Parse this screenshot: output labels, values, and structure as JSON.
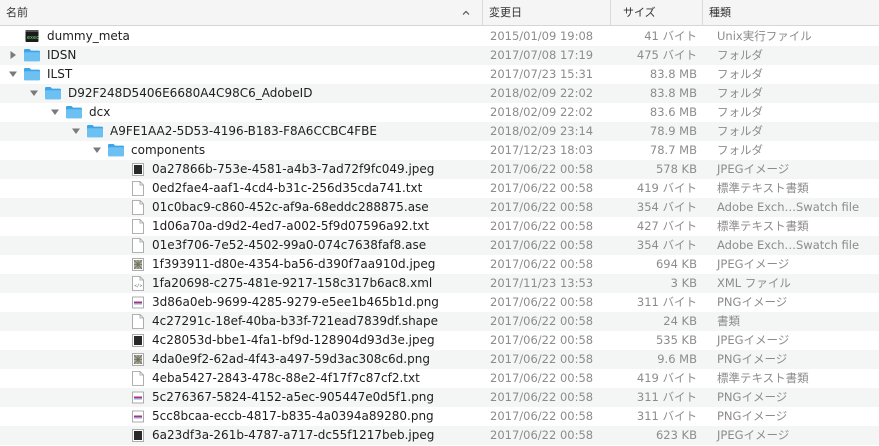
{
  "header": {
    "name": "名前",
    "date": "変更日",
    "size": "サイズ",
    "kind": "種類"
  },
  "rows": [
    {
      "name": "dummy_meta",
      "date": "2015/01/09 19:08",
      "size": "41 バイト",
      "kind": "Unix実行ファイル",
      "type": "exec",
      "level": 0
    },
    {
      "name": "IDSN",
      "date": "2017/07/08 17:19",
      "size": "475 バイト",
      "kind": "フォルダ",
      "type": "folder",
      "level": 0,
      "disclosure": "collapsed"
    },
    {
      "name": "ILST",
      "date": "2017/07/23 15:31",
      "size": "83.8 MB",
      "kind": "フォルダ",
      "type": "folder",
      "level": 0,
      "disclosure": "expanded"
    },
    {
      "name": "D92F248D5406E6680A4C98C6_AdobeID",
      "date": "2018/02/09 22:02",
      "size": "83.8 MB",
      "kind": "フォルダ",
      "type": "folder",
      "level": 1,
      "disclosure": "expanded"
    },
    {
      "name": "dcx",
      "date": "2018/02/09 22:02",
      "size": "83.6 MB",
      "kind": "フォルダ",
      "type": "folder",
      "level": 2,
      "disclosure": "expanded"
    },
    {
      "name": "A9FE1AA2-5D53-4196-B183-F8A6CCBC4FBE",
      "date": "2018/02/09 23:14",
      "size": "78.9 MB",
      "kind": "フォルダ",
      "type": "folder",
      "level": 3,
      "disclosure": "expanded"
    },
    {
      "name": "components",
      "date": "2017/12/23 18:03",
      "size": "78.7 MB",
      "kind": "フォルダ",
      "type": "folder",
      "level": 4,
      "disclosure": "expanded"
    },
    {
      "name": "0a27866b-753e-4581-a4b3-7ad72f9fc049.jpeg",
      "date": "2017/06/22 00:58",
      "size": "578 KB",
      "kind": "JPEGイメージ",
      "type": "jpeg-dark",
      "level": 5
    },
    {
      "name": "0ed2fae4-aaf1-4cd4-b31c-256d35cda741.txt",
      "date": "2017/06/22 00:58",
      "size": "419 バイト",
      "kind": "標準テキスト書類",
      "type": "doc",
      "level": 5
    },
    {
      "name": "01c0bac9-c860-452c-af9a-68eddc288875.ase",
      "date": "2017/06/22 00:58",
      "size": "354 バイト",
      "kind": "Adobe Exch…Swatch file",
      "type": "doc",
      "level": 5
    },
    {
      "name": "1d06a70a-d9d2-4ed7-a002-5f9d07596a92.txt",
      "date": "2017/06/22 00:58",
      "size": "427 バイト",
      "kind": "標準テキスト書類",
      "type": "doc",
      "level": 5
    },
    {
      "name": "01e3f706-7e52-4502-99a0-074c7638faf8.ase",
      "date": "2017/06/22 00:58",
      "size": "354 バイト",
      "kind": "Adobe Exch…Swatch file",
      "type": "doc",
      "level": 5
    },
    {
      "name": "1f393911-d80e-4354-ba56-d390f7aa910d.jpeg",
      "date": "2017/06/22 00:58",
      "size": "694 KB",
      "kind": "JPEGイメージ",
      "type": "jpeg-pattern",
      "level": 5
    },
    {
      "name": "1fa20698-c275-481e-9217-158c317b6ac8.xml",
      "date": "2017/11/23 13:53",
      "size": "3 KB",
      "kind": "XML ファイル",
      "type": "xml",
      "level": 5
    },
    {
      "name": "3d86a0eb-9699-4285-9279-e5ee1b465b1d.png",
      "date": "2017/06/22 00:58",
      "size": "311 バイト",
      "kind": "PNGイメージ",
      "type": "png-stripe",
      "level": 5
    },
    {
      "name": "4c27291c-18ef-40ba-b33f-721ead7839df.shape",
      "date": "2017/06/22 00:58",
      "size": "24 KB",
      "kind": "書類",
      "type": "doc",
      "level": 5
    },
    {
      "name": "4c28053d-bbe1-4fa1-bf9d-128904d93d3e.jpeg",
      "date": "2017/06/22 00:58",
      "size": "535 KB",
      "kind": "JPEGイメージ",
      "type": "jpeg-dark",
      "level": 5
    },
    {
      "name": "4da0e9f2-62ad-4f43-a497-59d3ac308c6d.png",
      "date": "2017/06/22 00:58",
      "size": "9.6 MB",
      "kind": "PNGイメージ",
      "type": "png-pattern",
      "level": 5
    },
    {
      "name": "4eba5427-2843-478c-88e2-4f17f7c87cf2.txt",
      "date": "2017/06/22 00:58",
      "size": "419 バイト",
      "kind": "標準テキスト書類",
      "type": "doc",
      "level": 5
    },
    {
      "name": "5c276367-5824-4152-a5ec-905447e0d5f1.png",
      "date": "2017/06/22 00:58",
      "size": "311 バイト",
      "kind": "PNGイメージ",
      "type": "png-stripe",
      "level": 5
    },
    {
      "name": "5cc8bcaa-eccb-4817-b835-4a0394a89280.png",
      "date": "2017/06/22 00:58",
      "size": "311 バイト",
      "kind": "PNGイメージ",
      "type": "png-stripe",
      "level": 5
    },
    {
      "name": "6a23df3a-261b-4787-a717-dc55f1217beb.jpeg",
      "date": "2017/06/22 00:58",
      "size": "623 KB",
      "kind": "JPEGイメージ",
      "type": "jpeg-dark",
      "level": 5
    }
  ],
  "colors": {
    "folder": "#3ea4e8",
    "folder_light": "#6cc0f2",
    "alt_row": "#f4f5f5",
    "secondary_text": "#8c8c8c"
  }
}
